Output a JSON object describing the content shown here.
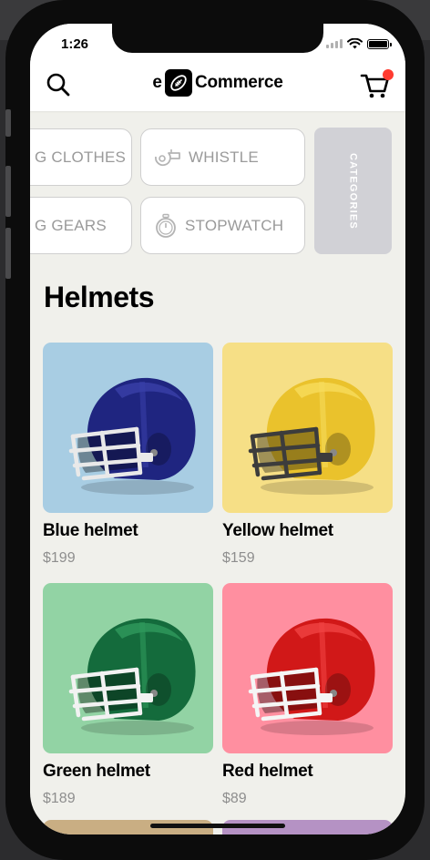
{
  "status": {
    "time": "1:26"
  },
  "header": {
    "brand_prefix": "e",
    "brand_name": "Commerce",
    "cart_badge_color": "#ff3b30"
  },
  "categories": {
    "chips": [
      {
        "label": "G CLOTHES",
        "icon": "none"
      },
      {
        "label": "WHISTLE",
        "icon": "whistle-icon"
      },
      {
        "label": "G GEARS",
        "icon": "none"
      },
      {
        "label": "STOPWATCH",
        "icon": "stopwatch-icon"
      }
    ],
    "tab_label": "CATEGORIES"
  },
  "section": {
    "title": "Helmets"
  },
  "products": [
    {
      "name": "Blue helmet",
      "price": "$199",
      "bg": "#a8cde3",
      "shell": "#1f2580",
      "shell_light": "#3a40a8",
      "mask": "#e9e9e9"
    },
    {
      "name": "Yellow helmet",
      "price": "$159",
      "bg": "#f6df86",
      "shell": "#eac22c",
      "shell_light": "#f7dc5c",
      "mask": "#3c3c3c"
    },
    {
      "name": "Green helmet",
      "price": "$189",
      "bg": "#92d3a4",
      "shell": "#146b3c",
      "shell_light": "#2f9a5c",
      "mask": "#f2f2f2"
    },
    {
      "name": "Red helmet",
      "price": "$89",
      "bg": "#ff8fa0",
      "shell": "#d11818",
      "shell_light": "#f04444",
      "mask": "#f5f5f5"
    }
  ],
  "peek_colors": [
    "#c9ae83",
    "#b592c4"
  ]
}
